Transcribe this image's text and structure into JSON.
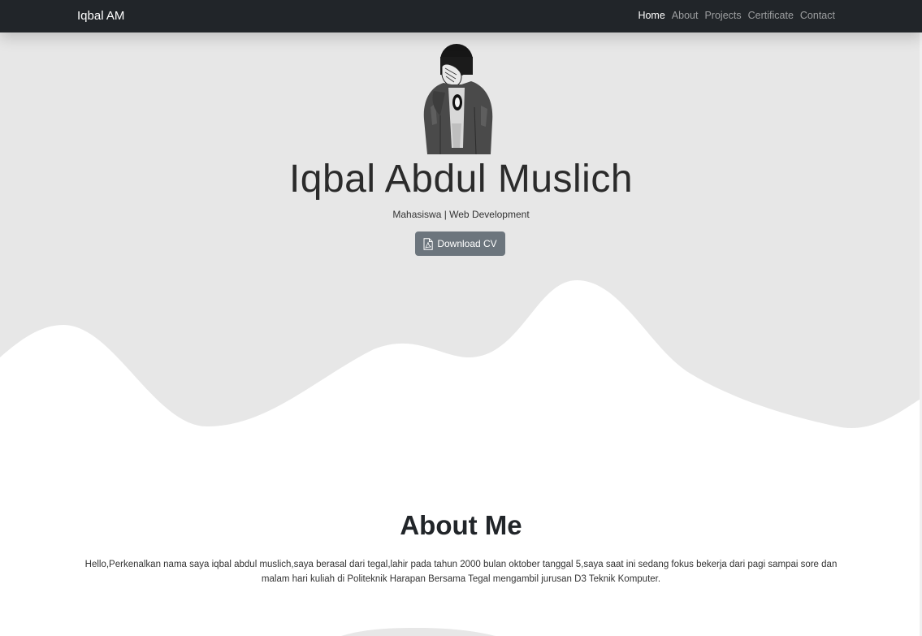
{
  "navbar": {
    "brand": "Iqbal AM",
    "links": [
      {
        "label": "Home",
        "active": true
      },
      {
        "label": "About",
        "active": false
      },
      {
        "label": "Projects",
        "active": false
      },
      {
        "label": "Certificate",
        "active": false
      },
      {
        "label": "Contact",
        "active": false
      }
    ]
  },
  "hero": {
    "title": "Iqbal Abdul Muslich",
    "subtitle": "Mahasiswa | Web Development",
    "cv_button_label": "Download CV",
    "cv_icon": "file-pdf-icon"
  },
  "about": {
    "title": "About Me",
    "text": "Hello,Perkenalkan nama saya iqbal abdul muslich,saya berasal dari tegal,lahir pada tahun 2000 bulan oktober tanggal 5,saya saat ini sedang fokus bekerja dari pagi sampai sore dan malam hari kuliah di Politeknik Harapan Bersama Tegal mengambil jurusan D3 Teknik Komputer."
  },
  "colors": {
    "navbar_bg": "#212529",
    "hero_bg": "#e7e7e7",
    "button_bg": "#6c757d"
  }
}
